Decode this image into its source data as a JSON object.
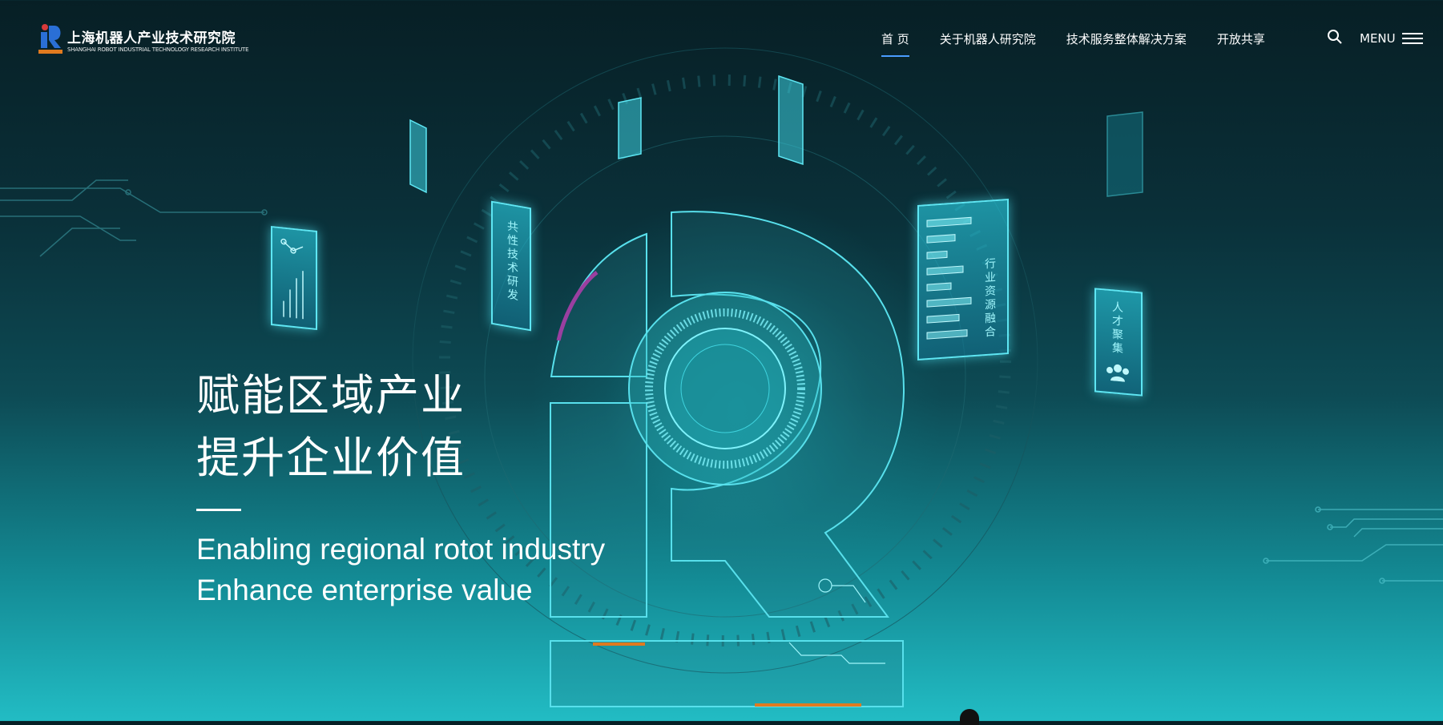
{
  "header": {
    "logo_cn": "上海机器人产业技术研究院",
    "logo_en": "SHANGHAI ROBOT INDUSTRIAL TECHNOLOGY RESEARCH INSTITUTE",
    "nav": [
      {
        "label": "首 页",
        "active": true
      },
      {
        "label": "关于机器人研究院",
        "active": false
      },
      {
        "label": "技术服务整体解决方案",
        "active": false
      },
      {
        "label": "开放共享",
        "active": false
      }
    ],
    "search_icon": "search-icon",
    "menu_label": "MENU",
    "menu_icon": "hamburger-icon"
  },
  "hero": {
    "line1": "赋能区域产业",
    "line2": "提升企业价值",
    "en_line1": "Enabling regional rotot industry",
    "en_line2": "Enhance enterprise value"
  },
  "panels": {
    "tech": "共性技术研发",
    "resource": "行业资源融合",
    "talent": "人才聚集"
  },
  "colors": {
    "accent": "#4a9cff",
    "cyan": "#5ee6f3",
    "orange": "#e07a1f",
    "logo_blue": "#2a6fd6",
    "logo_red": "#d83a3a"
  }
}
